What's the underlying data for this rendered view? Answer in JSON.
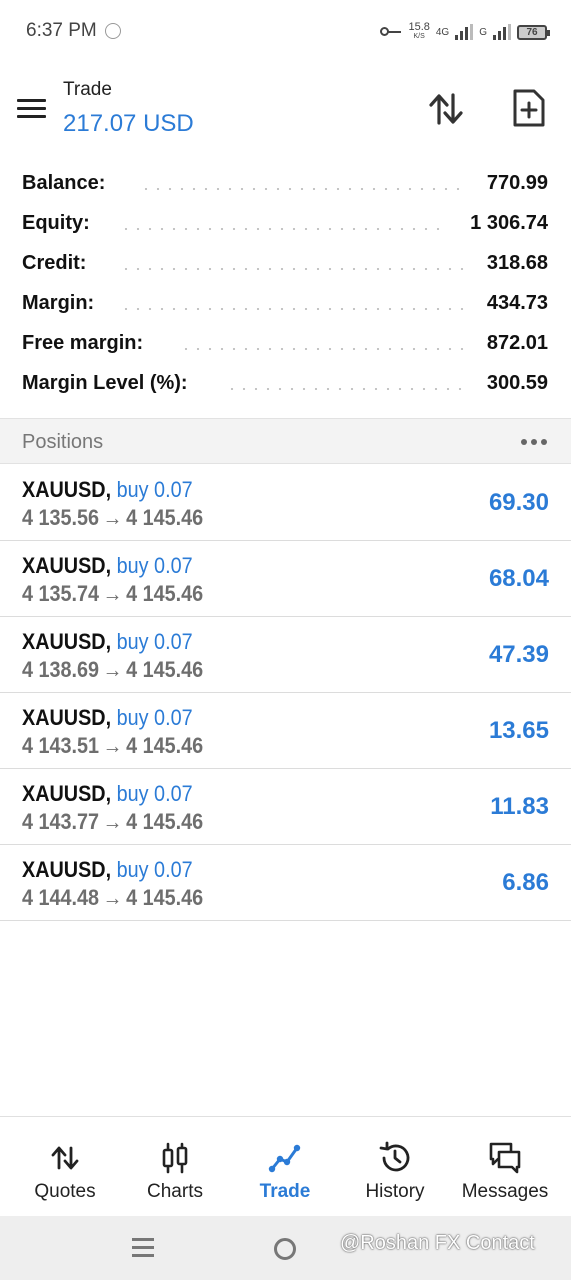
{
  "status_bar": {
    "time": "6:37 PM",
    "speed_value": "15.8",
    "speed_unit": "K/S",
    "network_1": "4G",
    "network_2": "G",
    "battery": "76"
  },
  "header": {
    "title": "Trade",
    "amount": "217.07 USD",
    "icons": [
      "menu-icon",
      "sort-icon",
      "new-order-icon"
    ]
  },
  "summary": [
    {
      "label": "Balance:",
      "value": "770.99"
    },
    {
      "label": "Equity:",
      "value": "1 306.74"
    },
    {
      "label": "Credit:",
      "value": "318.68"
    },
    {
      "label": "Margin:",
      "value": "434.73"
    },
    {
      "label": "Free margin:",
      "value": "872.01"
    },
    {
      "label": "Margin Level (%):",
      "value": "300.59"
    }
  ],
  "positions": {
    "title": "Positions",
    "rows": [
      {
        "symbol": "XAUUSD,",
        "type": "buy 0.07",
        "open_price": "4 135.56",
        "arrow": "→",
        "current_price": "4 145.46",
        "profit": "69.30"
      },
      {
        "symbol": "XAUUSD,",
        "type": "buy 0.07",
        "open_price": "4 135.74",
        "arrow": "→",
        "current_price": "4 145.46",
        "profit": "68.04"
      },
      {
        "symbol": "XAUUSD,",
        "type": "buy 0.07",
        "open_price": "4 138.69",
        "arrow": "→",
        "current_price": "4 145.46",
        "profit": "47.39"
      },
      {
        "symbol": "XAUUSD,",
        "type": "buy 0.07",
        "open_price": "4 143.51",
        "arrow": "→",
        "current_price": "4 145.46",
        "profit": "13.65"
      },
      {
        "symbol": "XAUUSD,",
        "type": "buy 0.07",
        "open_price": "4 143.77",
        "arrow": "→",
        "current_price": "4 145.46",
        "profit": "11.83"
      },
      {
        "symbol": "XAUUSD,",
        "type": "buy 0.07",
        "open_price": "4 144.48",
        "arrow": "→",
        "current_price": "4 145.46",
        "profit": "6.86"
      }
    ]
  },
  "bottom_nav": [
    {
      "label": "Quotes",
      "icon": "quotes-icon",
      "active": false
    },
    {
      "label": "Charts",
      "icon": "charts-icon",
      "active": false
    },
    {
      "label": "Trade",
      "icon": "trade-icon",
      "active": true
    },
    {
      "label": "History",
      "icon": "history-icon",
      "active": false
    },
    {
      "label": "Messages",
      "icon": "messages-icon",
      "active": false
    }
  ],
  "watermark": "@Roshan FX Contact",
  "colors": {
    "accent": "#2b7bd6",
    "text": "#111111",
    "muted": "#6e6e6e"
  }
}
